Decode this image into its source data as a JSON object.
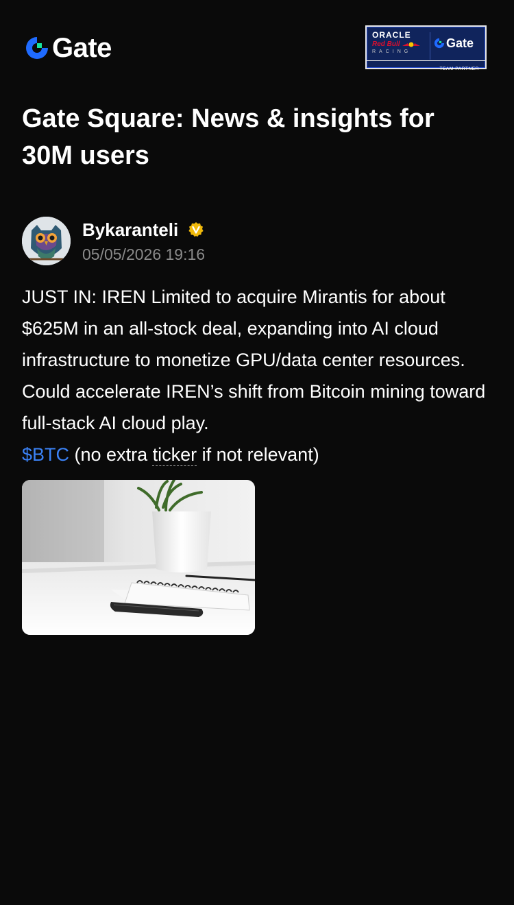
{
  "header": {
    "logo_text": "Gate",
    "partner": {
      "line1": "ORACLE",
      "line2": "Red Bull",
      "line3": "RACING",
      "brand": "Gate",
      "footer": "TEAM PARTNER"
    }
  },
  "page": {
    "title": "Gate Square: News & insights for 30M users"
  },
  "post": {
    "author": "Bykaranteli",
    "verified_icon": "verified-badge-icon",
    "timestamp": "05/05/2026 19:16",
    "body_main": "JUST IN: IREN Limited to acquire Mirantis for about $625M in an all-stock deal, expanding into AI cloud infrastructure to monetize GPU/data center resources. Could accelerate IREN’s shift from Bitcoin mining toward full-stack AI cloud play.",
    "ticker": "$BTC",
    "body_after_ticker_1": " (no extra ",
    "body_dotted_word": "ticker",
    "body_after_ticker_2": " if not relevant)",
    "image_description_icon": "post-image"
  },
  "colors": {
    "background": "#0a0a0a",
    "brand_blue": "#1f6bff",
    "brand_green": "#17e5a0",
    "link_blue": "#3b82f6",
    "verified_gold": "#f0b90b",
    "muted_text": "#8a8a8a"
  }
}
